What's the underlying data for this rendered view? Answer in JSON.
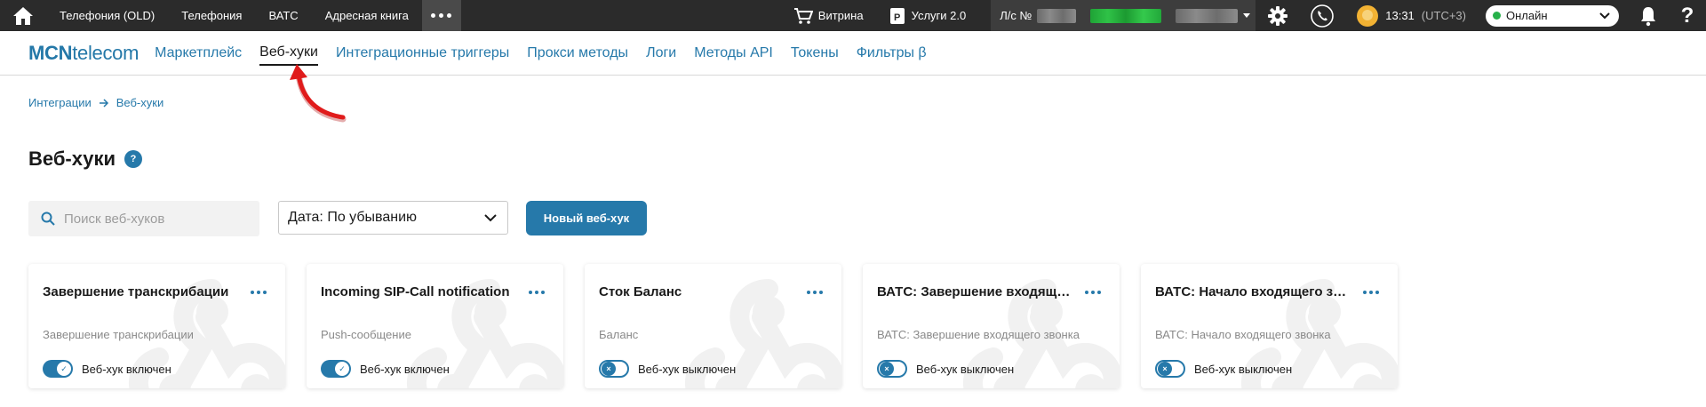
{
  "topbar": {
    "nav": [
      "Телефония (OLD)",
      "Телефония",
      "ВАТС",
      "Адресная книга"
    ],
    "showcase_label": "Витрина",
    "services_label": "Услуги 2.0",
    "account_label": "Л/с №",
    "time": "13:31",
    "timezone": "(UTC+3)",
    "status": "Онлайн",
    "help": "?"
  },
  "subnav": {
    "logo_bold": "MCN",
    "logo_light": "telecom",
    "tabs": [
      "Маркетплейс",
      "Веб-хуки",
      "Интеграционные триггеры",
      "Прокси методы",
      "Логи",
      "Методы API",
      "Токены",
      "Фильтры β"
    ],
    "active_tab": "Веб-хуки"
  },
  "breadcrumb": {
    "root": "Интеграции",
    "current": "Веб-хуки"
  },
  "page": {
    "title": "Веб-хуки",
    "help": "?"
  },
  "toolbar": {
    "search_placeholder": "Поиск веб-хуков",
    "sort_value": "Дата: По убыванию",
    "new_button": "Новый веб-хук"
  },
  "cards": [
    {
      "title": "Завершение транскрибации",
      "subtitle": "Завершение транскрибации",
      "enabled": true,
      "status": "Веб-хук включен"
    },
    {
      "title": "Incoming SIP-Call notification",
      "subtitle": "Push-сообщение",
      "enabled": true,
      "status": "Веб-хук включен"
    },
    {
      "title": "Сток Баланс",
      "subtitle": "Баланс",
      "enabled": false,
      "status": "Веб-хук выключен"
    },
    {
      "title": "ВАТС: Завершение входящего звонка",
      "subtitle": "ВАТС: Завершение входящего звонка",
      "enabled": false,
      "status": "Веб-хук выключен"
    },
    {
      "title": "ВАТС: Начало входящего звонка",
      "subtitle": "ВАТС: Начало входящего звонка",
      "enabled": false,
      "status": "Веб-хук выключен"
    }
  ],
  "colors": {
    "accent": "#2679aa",
    "topbar": "#2b2b2b",
    "online": "#27b14a",
    "annotation": "#e01b1b"
  }
}
